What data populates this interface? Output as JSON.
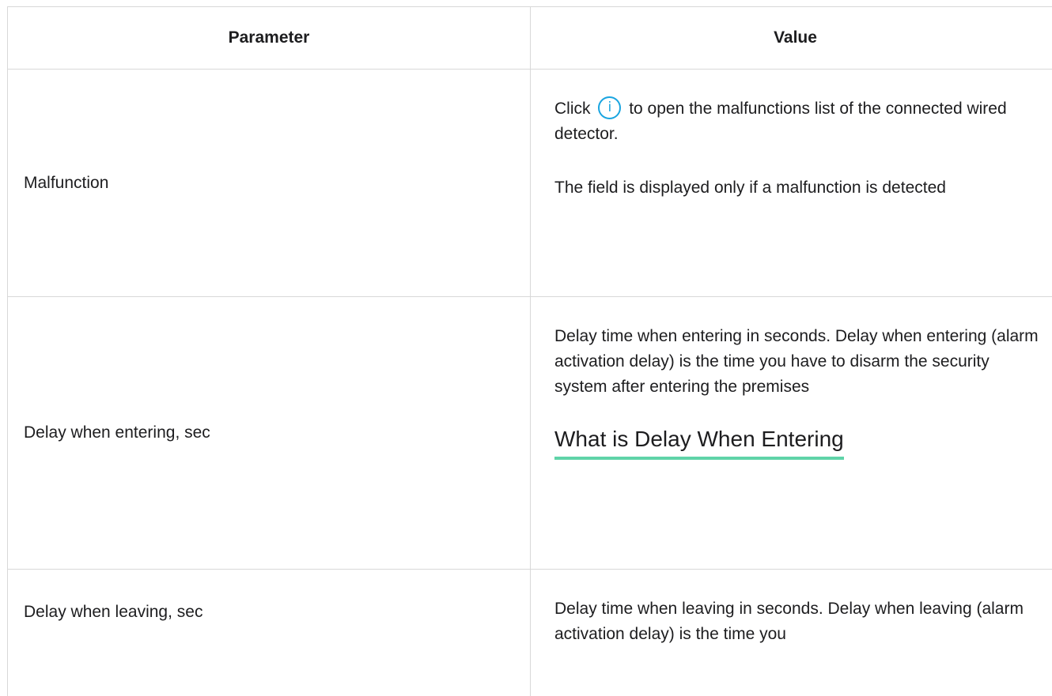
{
  "table": {
    "headers": {
      "parameter": "Parameter",
      "value": "Value"
    },
    "rows": [
      {
        "parameter": "Malfunction",
        "value_before_icon": "Click",
        "value_after_icon": "to open the malfunctions list of the connected wired detector.",
        "value_note": "The field is displayed only if a malfunction is detected",
        "icon": "info-icon"
      },
      {
        "parameter": "Delay when entering, sec",
        "value": "Delay time when entering in seconds. Delay when entering (alarm activation delay) is the time you have to disarm the security system after entering the premises",
        "link": "What is Delay When Entering"
      },
      {
        "parameter": "Delay when leaving, sec",
        "value": "Delay time when leaving in seconds. Delay when leaving (alarm activation delay) is the time you"
      }
    ]
  },
  "colors": {
    "accent_icon": "#1aa5e0",
    "link_underline": "#5fd3a8",
    "border": "#d8d8d8",
    "text": "#1d1d1f"
  }
}
